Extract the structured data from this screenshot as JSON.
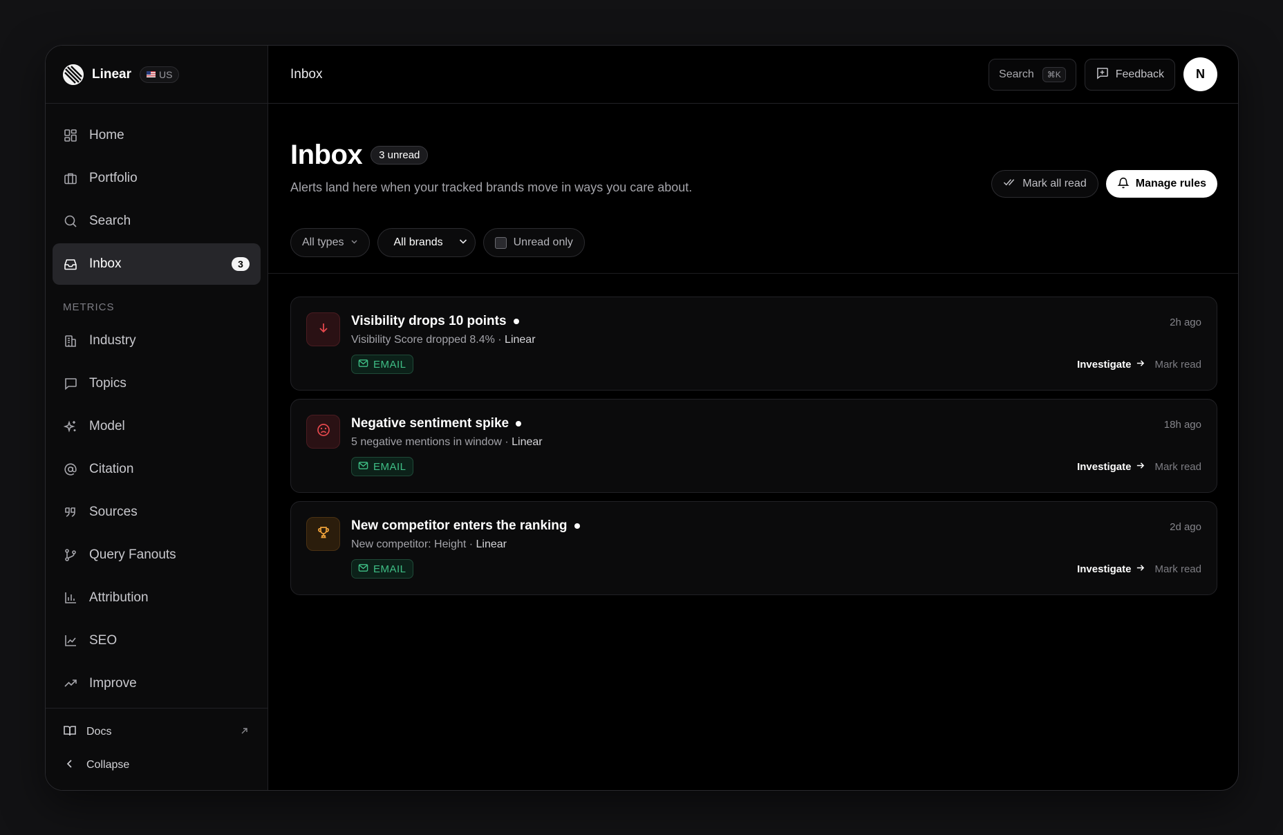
{
  "brand": {
    "name": "Linear",
    "region": "US"
  },
  "sidebar": {
    "items": [
      {
        "label": "Home",
        "icon": "home-grid-icon"
      },
      {
        "label": "Portfolio",
        "icon": "briefcase-icon"
      },
      {
        "label": "Search",
        "icon": "search-icon"
      },
      {
        "label": "Inbox",
        "icon": "inbox-icon",
        "count": "3",
        "active": true
      }
    ],
    "section_label": "METRICS",
    "metrics": [
      {
        "label": "Industry",
        "icon": "building-icon"
      },
      {
        "label": "Topics",
        "icon": "message-square-icon"
      },
      {
        "label": "Model",
        "icon": "sparkles-icon"
      },
      {
        "label": "Citation",
        "icon": "at-sign-icon"
      },
      {
        "label": "Sources",
        "icon": "quote-icon"
      },
      {
        "label": "Query Fanouts",
        "icon": "git-branch-icon"
      },
      {
        "label": "Attribution",
        "icon": "bar-chart-icon"
      },
      {
        "label": "SEO",
        "icon": "line-chart-icon"
      },
      {
        "label": "Improve",
        "icon": "trending-up-icon"
      }
    ],
    "footer": {
      "docs": "Docs",
      "collapse": "Collapse"
    }
  },
  "topbar": {
    "title": "Inbox",
    "search_label": "Search",
    "search_shortcut": "⌘K",
    "feedback_label": "Feedback",
    "avatar_initial": "N"
  },
  "page": {
    "title": "Inbox",
    "unread_badge": "3 unread",
    "subtitle": "Alerts land here when your tracked brands move in ways you care about.",
    "mark_all_read": "Mark all read",
    "manage_rules": "Manage rules"
  },
  "filters": {
    "types": "All types",
    "brands": "All brands",
    "unread_only": "Unread only"
  },
  "alerts": [
    {
      "title": "Visibility drops 10 points",
      "desc": "Visibility Score dropped 8.4% · ",
      "brand": "Linear",
      "channel": "EMAIL",
      "time": "2h ago",
      "investigate": "Investigate",
      "mark_read": "Mark read",
      "icon": "arrow-down-icon",
      "color": "#e5484d"
    },
    {
      "title": "Negative sentiment spike",
      "desc": "5 negative mentions in window · ",
      "brand": "Linear",
      "channel": "EMAIL",
      "time": "18h ago",
      "investigate": "Investigate",
      "mark_read": "Mark read",
      "icon": "frown-icon",
      "color": "#e5484d"
    },
    {
      "title": "New competitor enters the ranking",
      "desc": "New competitor: Height · ",
      "brand": "Linear",
      "channel": "EMAIL",
      "time": "2d ago",
      "investigate": "Investigate",
      "mark_read": "Mark read",
      "icon": "trophy-icon",
      "color": "#f0a23a"
    }
  ],
  "colors": {
    "background": "#121214",
    "panel": "#000000",
    "sidebar": "#0b0b0c",
    "email_chip": "#3fbf86"
  }
}
